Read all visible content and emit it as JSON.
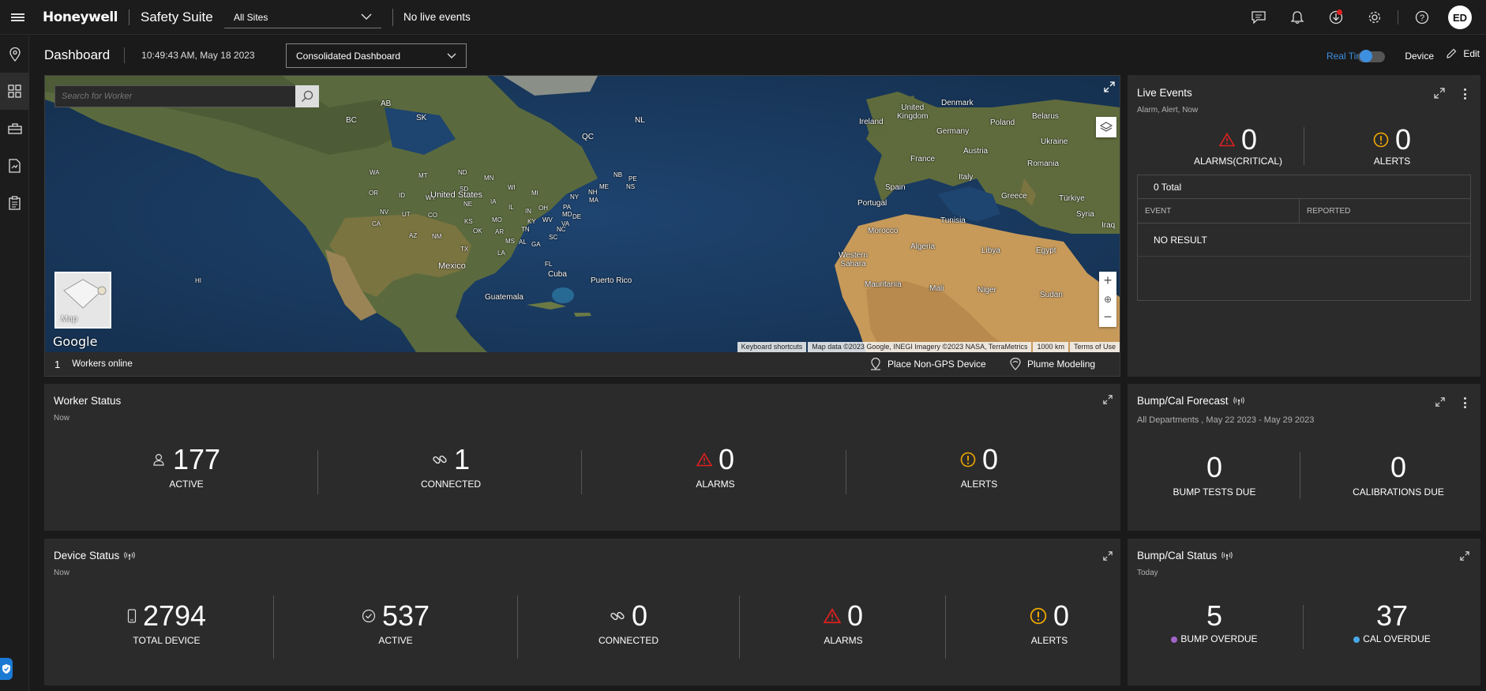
{
  "topbar": {
    "brand": "Honeywell",
    "product": "Safety Suite",
    "site_select": "All Sites",
    "live_status": "No live events",
    "user_initials": "ED"
  },
  "dashboard": {
    "title": "Dashboard",
    "timestamp": "10:49:43 AM, May 18 2023",
    "view_select": "Consolidated Dashboard",
    "realtime_label": "Real Time",
    "device_label": "Device",
    "edit_label": "Edit"
  },
  "map": {
    "search_placeholder": "Search for Worker",
    "workers_online_count": "1",
    "workers_online_label": "Workers online",
    "place_device_label": "Place Non-GPS Device",
    "plume_label": "Plume Modeling",
    "map_type_label": "Map",
    "google_label": "Google",
    "attribution": [
      "Keyboard shortcuts",
      "Map data ©2023 Google, INEGI Imagery ©2023 NASA, TerraMetrics",
      "1000 km",
      "Terms of Use"
    ],
    "place_labels": [
      "AB",
      "SK",
      "BC",
      "QC",
      "NL",
      "WA",
      "MT",
      "ND",
      "MN",
      "OR",
      "ID",
      "WY",
      "SD",
      "WI",
      "MI",
      "NB",
      "PE",
      "NS",
      "ME",
      "NH",
      "MA",
      "NY",
      "CA",
      "NV",
      "UT",
      "NE",
      "IA",
      "IL",
      "IN",
      "OH",
      "PA",
      "CO",
      "KS",
      "MO",
      "KY",
      "WV",
      "VA",
      "MD",
      "DE",
      "AZ",
      "NM",
      "OK",
      "AR",
      "TN",
      "NC",
      "TX",
      "MS",
      "AL",
      "GA",
      "SC",
      "LA",
      "FL",
      "HI",
      "United States",
      "Mexico",
      "Cuba",
      "Puerto Rico",
      "Guatemala",
      "United Kingdom",
      "Ireland",
      "Denmark",
      "Belarus",
      "Poland",
      "Germany",
      "Ukraine",
      "Austria",
      "France",
      "Romania",
      "Italy",
      "Spain",
      "Portugal",
      "Greece",
      "Türkiye",
      "Tunisia",
      "Morocco",
      "Algeria",
      "Libya",
      "Egypt",
      "Syria",
      "Iraq",
      "Western Sahara",
      "Mauritania",
      "Mali",
      "Niger",
      "Sudan"
    ]
  },
  "live_events": {
    "title": "Live Events",
    "subtitle": "Alarm, Alert, Now",
    "alarms_value": "0",
    "alarms_label": "ALARMS(CRITICAL)",
    "alerts_value": "0",
    "alerts_label": "ALERTS",
    "total": "0 Total",
    "col_event": "EVENT",
    "col_reported": "REPORTED",
    "empty": "NO RESULT"
  },
  "worker_status": {
    "title": "Worker Status",
    "subtitle": "Now",
    "stats": [
      {
        "value": "177",
        "label": "ACTIVE",
        "icon": "worker-icon"
      },
      {
        "value": "1",
        "label": "CONNECTED",
        "icon": "link-icon"
      },
      {
        "value": "0",
        "label": "ALARMS",
        "icon": "alarm-icon"
      },
      {
        "value": "0",
        "label": "ALERTS",
        "icon": "alert-icon"
      }
    ]
  },
  "bump_forecast": {
    "title": "Bump/Cal Forecast",
    "subtitle": "All Departments , May 22 2023 - May 29 2023",
    "bump_value": "0",
    "bump_label": "BUMP TESTS DUE",
    "cal_value": "0",
    "cal_label": "CALIBRATIONS DUE"
  },
  "device_status": {
    "title": "Device Status",
    "subtitle": "Now",
    "stats": [
      {
        "value": "2794",
        "label": "TOTAL DEVICE",
        "icon": "device-icon"
      },
      {
        "value": "537",
        "label": "ACTIVE",
        "icon": "check-icon"
      },
      {
        "value": "0",
        "label": "CONNECTED",
        "icon": "link-icon"
      },
      {
        "value": "0",
        "label": "ALARMS",
        "icon": "alarm-icon"
      },
      {
        "value": "0",
        "label": "ALERTS",
        "icon": "alert-icon"
      }
    ]
  },
  "bump_status": {
    "title": "Bump/Cal Status",
    "subtitle": "Today",
    "bump_value": "5",
    "bump_label": "BUMP OVERDUE",
    "cal_value": "37",
    "cal_label": "CAL OVERDUE"
  },
  "colors": {
    "accent": "#3d8fe0",
    "alarm": "#e02020",
    "alert": "#f0a800",
    "bump_dot": "#a264c8",
    "cal_dot": "#47a8e8"
  }
}
